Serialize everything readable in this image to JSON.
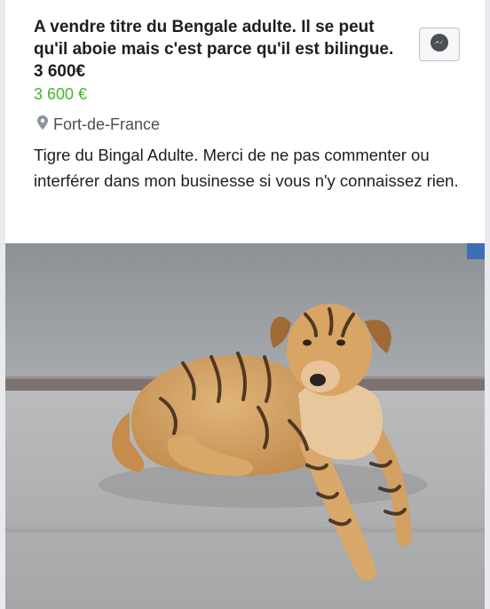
{
  "listing": {
    "title": "A vendre titre du Bengale adulte. Il se peut qu'il aboie mais c'est parce qu'il est bilingue. 3 600€",
    "price": "3 600 €",
    "location": "Fort-de-France",
    "description": "Tigre du Bingal Adulte. Merci de ne pas commenter ou interférer dans mon businesse si vous n'y connaissez rien."
  },
  "icons": {
    "message": "messenger-icon",
    "location": "location-pin-icon"
  },
  "colors": {
    "price": "#42b72a",
    "background": "#ffffff"
  }
}
